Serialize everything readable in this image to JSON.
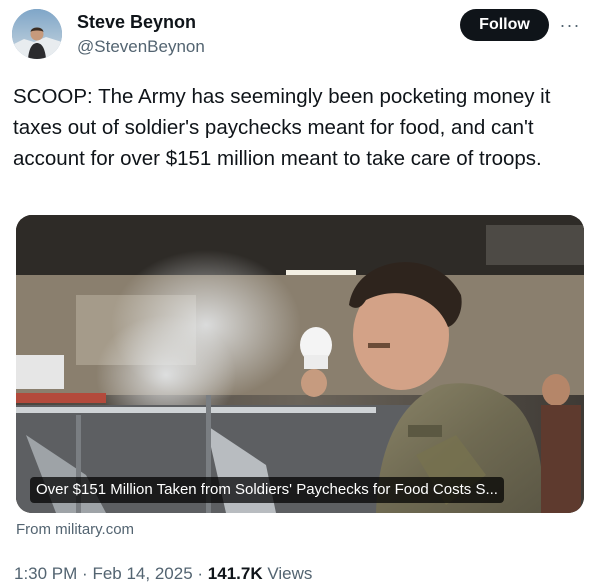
{
  "author": {
    "name": "Steve Beynon",
    "handle": "@StevenBeynon"
  },
  "actions": {
    "follow_label": "Follow",
    "more_label": "···"
  },
  "tweet": {
    "text": "SCOOP: The Army has seemingly been pocketing money it taxes out of soldier's paychecks meant for food, and can't account for over $151 million meant to take care of troops."
  },
  "card": {
    "title": "Over $151 Million Taken from Soldiers' Paychecks for Food Costs S...",
    "source": "From military.com"
  },
  "meta": {
    "time": "1:30 PM",
    "separator1": "·",
    "date": "Feb 14, 2025",
    "separator2": "·",
    "views_count": "141.7K",
    "views_label": "Views"
  },
  "colors": {
    "text_primary": "#0f1419",
    "text_secondary": "#536471",
    "button_bg": "#0f1419",
    "button_text": "#ffffff"
  },
  "icons": {
    "more": "more-horizontal-icon"
  }
}
